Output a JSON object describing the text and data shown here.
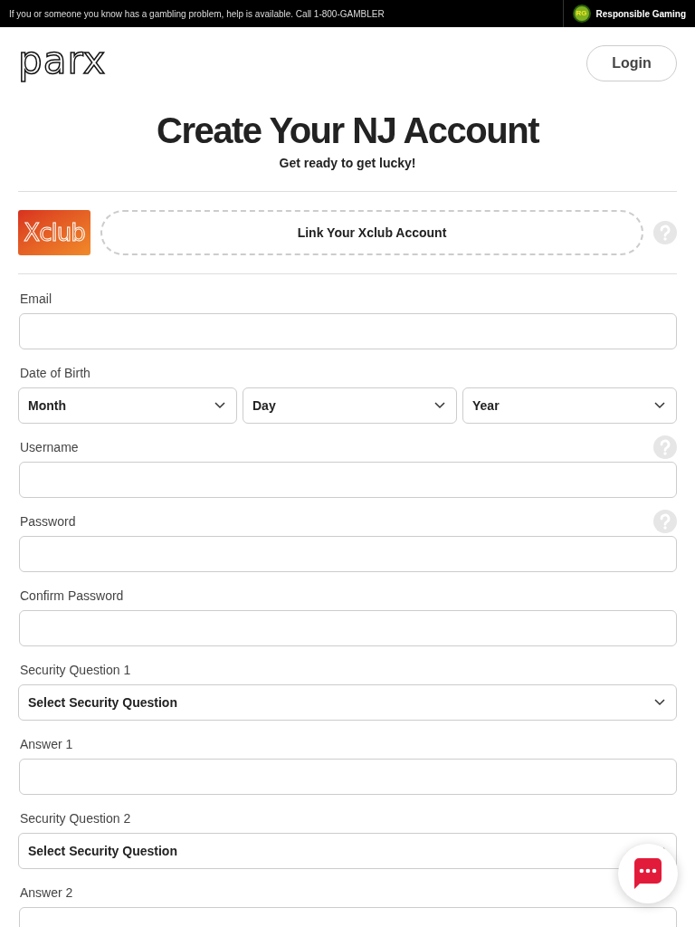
{
  "top_bar": {
    "message": "If you or someone you know has a gambling problem, help is available. Call 1-800-GAMBLER",
    "badge": "RG",
    "link": "Responsible Gaming"
  },
  "header": {
    "logo": "parx",
    "login_button": "Login"
  },
  "title": "Create Your NJ Account",
  "subtitle": "Get ready to get lucky!",
  "xclub": {
    "card_logo": "Xclub",
    "button": "Link Your Xclub Account",
    "help": true
  },
  "fields": [
    {
      "kind": "text",
      "label": "Email",
      "help": false
    },
    {
      "kind": "date",
      "label": "Date of Birth",
      "help": false,
      "selects": [
        "Month",
        "Day",
        "Year"
      ]
    },
    {
      "kind": "text",
      "label": "Username",
      "help": true
    },
    {
      "kind": "text",
      "label": "Password",
      "help": true
    },
    {
      "kind": "text",
      "label": "Confirm Password",
      "help": false
    },
    {
      "kind": "select",
      "label": "Security Question 1",
      "help": false,
      "placeholder": "Select Security Question"
    },
    {
      "kind": "text",
      "label": "Answer 1",
      "help": false
    },
    {
      "kind": "select",
      "label": "Security Question 2",
      "help": false,
      "placeholder": "Select Security Question"
    },
    {
      "kind": "text",
      "label": "Answer 2",
      "help": false
    }
  ]
}
